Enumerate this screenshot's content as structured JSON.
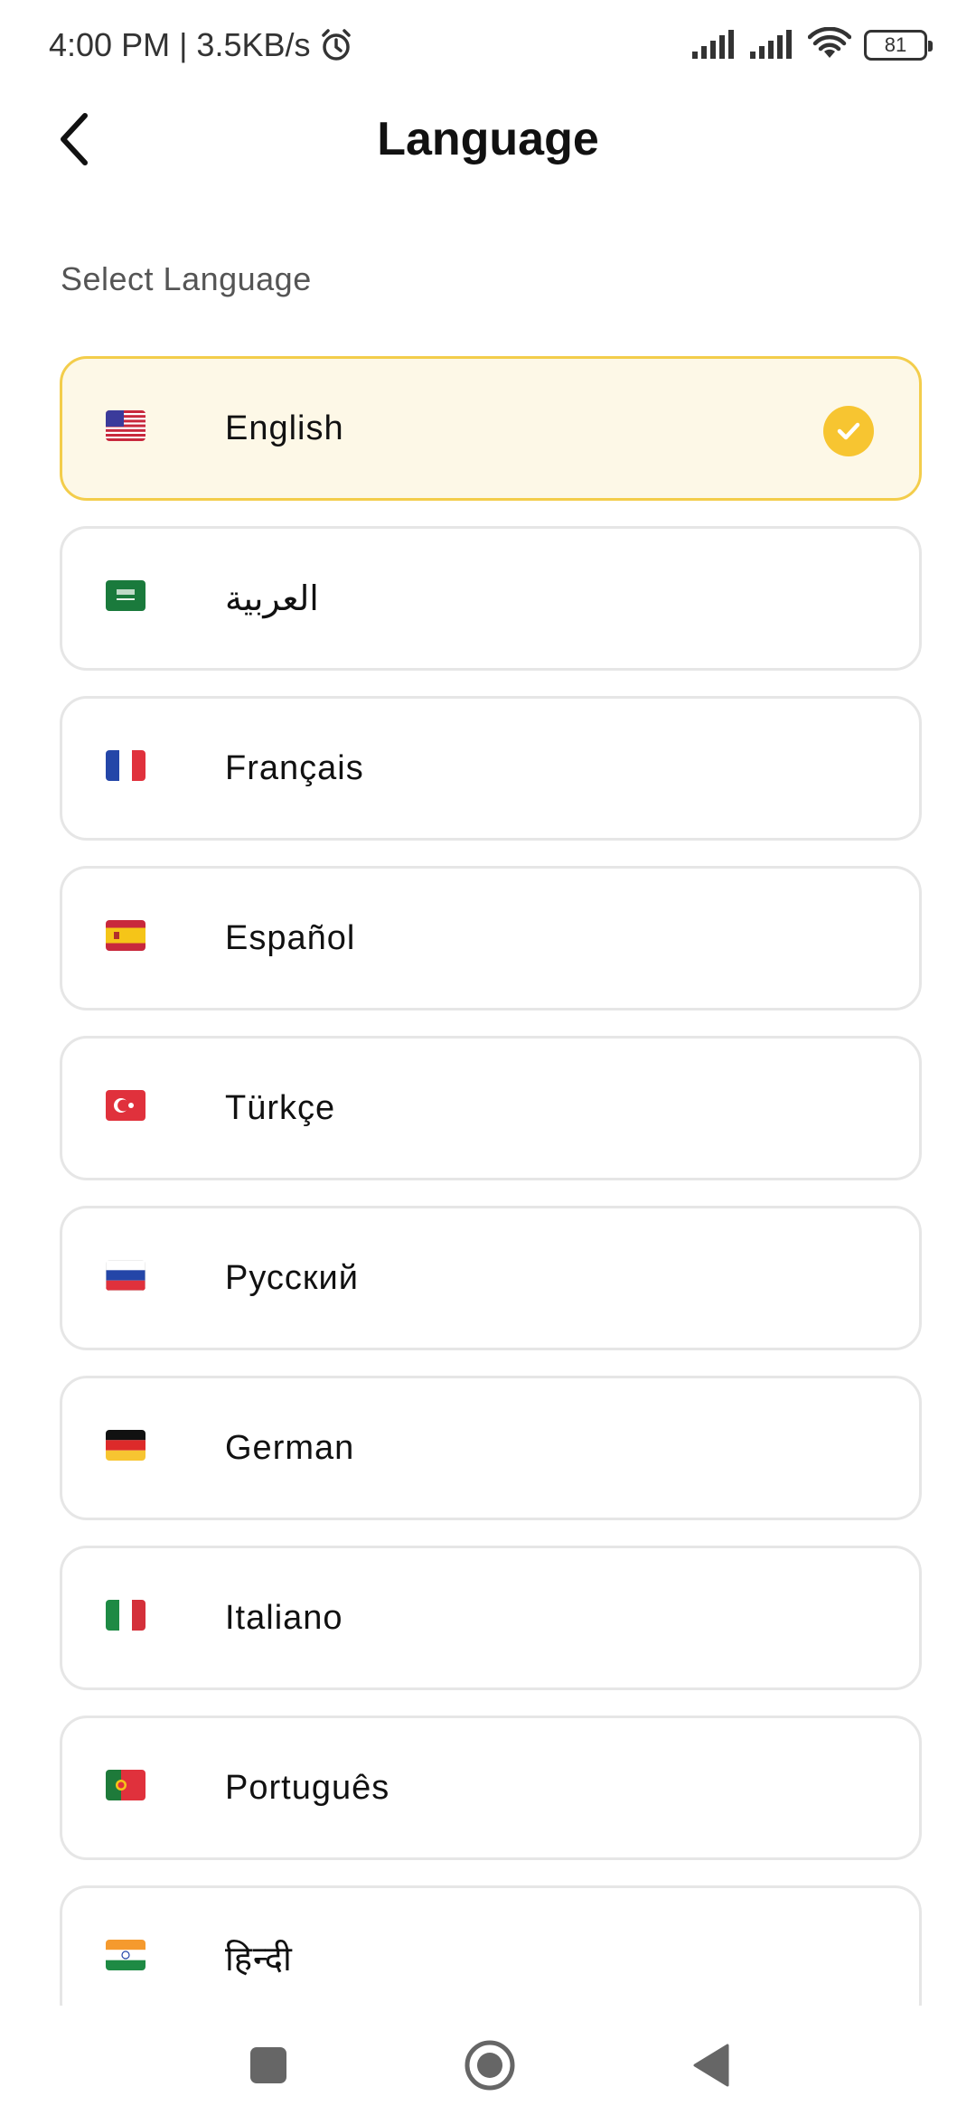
{
  "status_bar": {
    "time_speed": "4:00 PM | 3.5KB/s",
    "battery": "81"
  },
  "header": {
    "title": "Language"
  },
  "section_label": "Select Language",
  "languages": [
    {
      "label": "English",
      "flag": "us-flag",
      "selected": true
    },
    {
      "label": "العربية",
      "flag": "saudi-flag",
      "selected": false
    },
    {
      "label": "Français",
      "flag": "france-flag",
      "selected": false
    },
    {
      "label": "Español",
      "flag": "spain-flag",
      "selected": false
    },
    {
      "label": "Türkçe",
      "flag": "turkey-flag",
      "selected": false
    },
    {
      "label": "Русский",
      "flag": "russia-flag",
      "selected": false
    },
    {
      "label": "German",
      "flag": "germany-flag",
      "selected": false
    },
    {
      "label": "Italiano",
      "flag": "italy-flag",
      "selected": false
    },
    {
      "label": "Português",
      "flag": "portugal-flag",
      "selected": false
    },
    {
      "label": "हिन्दी",
      "flag": "india-flag",
      "selected": false
    }
  ],
  "colors": {
    "selected_bg": "#fdf8e7",
    "selected_border": "#f3cd4b",
    "check": "#f7c531",
    "border": "#e6e6e6"
  }
}
